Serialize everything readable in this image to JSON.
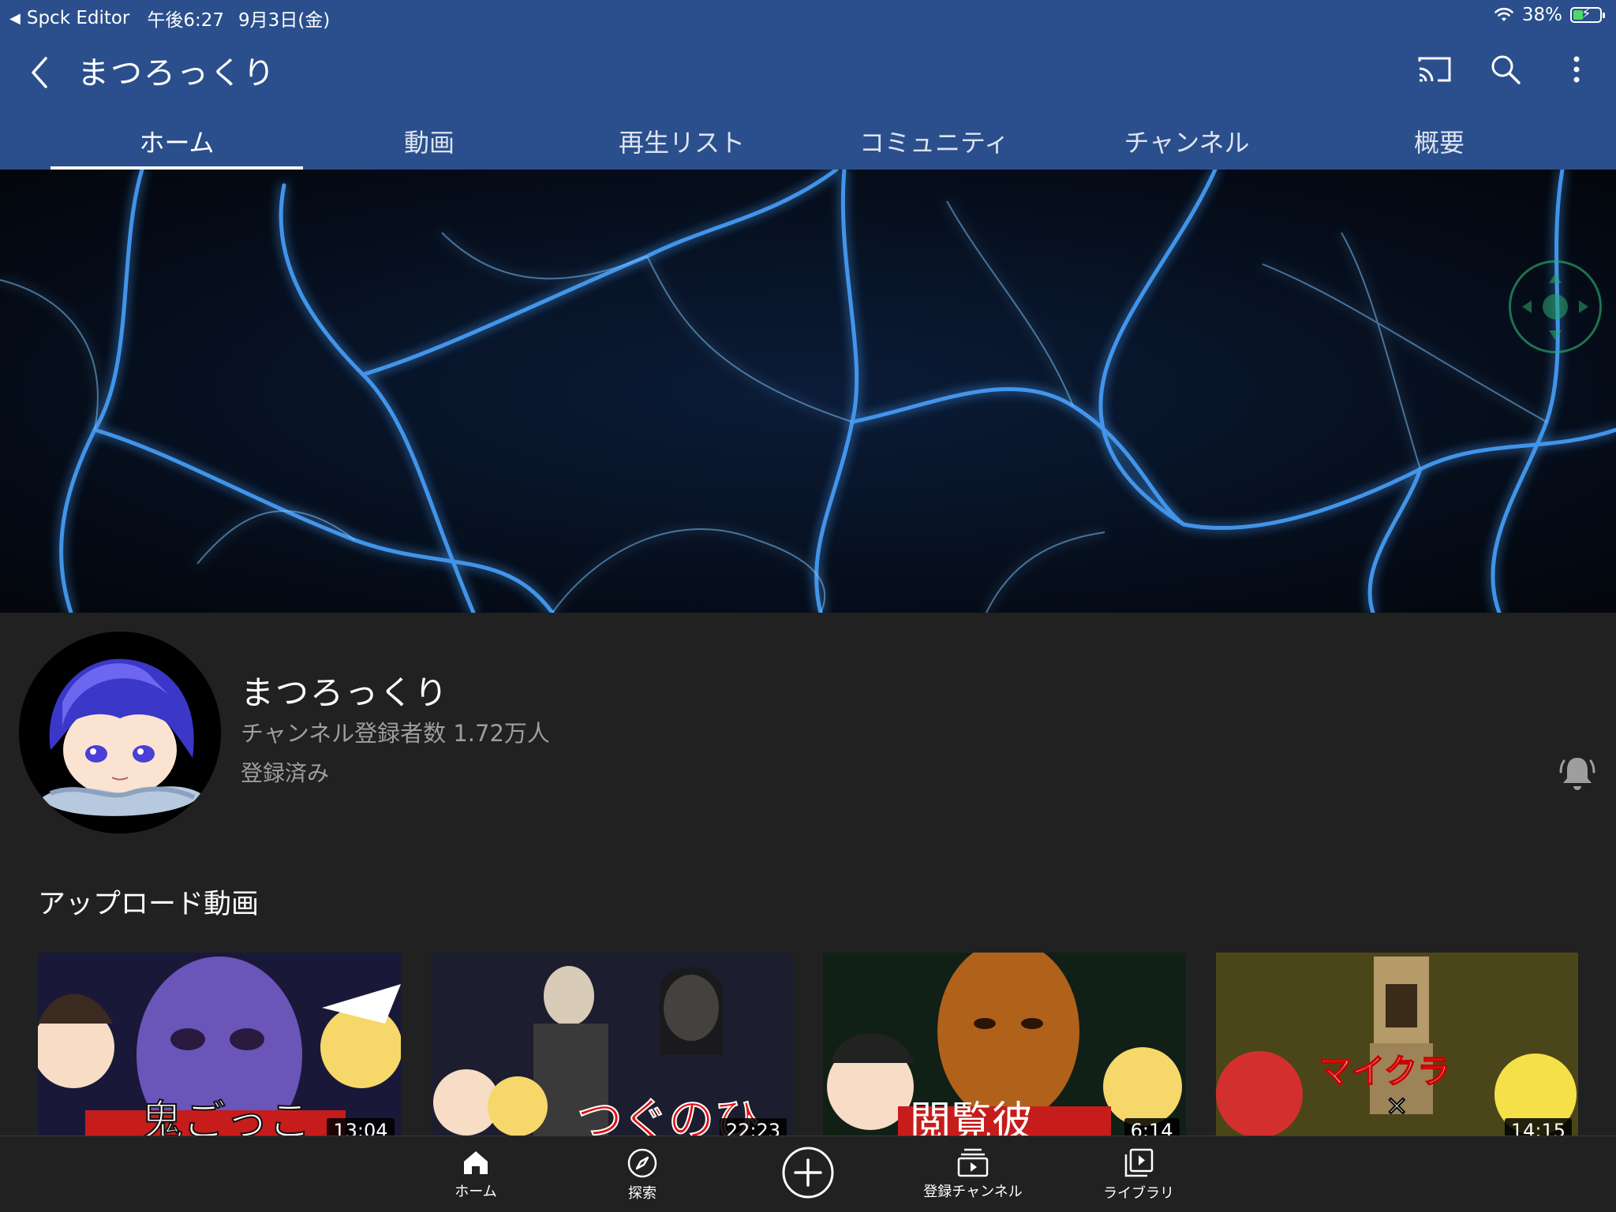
{
  "status_bar": {
    "app_back": "Spck Editor",
    "time": "午後6:27",
    "date": "9月3日(金)",
    "battery": "38%",
    "battery_level": 0.38
  },
  "header": {
    "title": "まつろっくり",
    "icons": [
      "back-chevron-icon",
      "cast-icon",
      "search-icon",
      "more-vert-icon"
    ]
  },
  "tabs": [
    {
      "label": "ホーム",
      "active": true
    },
    {
      "label": "動画",
      "active": false
    },
    {
      "label": "再生リスト",
      "active": false
    },
    {
      "label": "コミュニティ",
      "active": false
    },
    {
      "label": "チャンネル",
      "active": false
    },
    {
      "label": "概要",
      "active": false
    }
  ],
  "channel": {
    "name": "まつろっくり",
    "subscribers": "チャンネル登録者数 1.72万人",
    "subscription_state": "登録済み"
  },
  "uploads": {
    "section_title": "アップロード動画",
    "videos": [
      {
        "duration": "13:04",
        "overlay_text": "鬼ごっこ"
      },
      {
        "duration": "22:23",
        "overlay_text": "つぐのひ"
      },
      {
        "duration": "6:14",
        "overlay_text": "閲覧彼"
      },
      {
        "duration": "14:15",
        "overlay_text": "マイクラ"
      }
    ]
  },
  "bottom_nav": [
    {
      "label": "ホーム",
      "icon": "home-icon"
    },
    {
      "label": "探索",
      "icon": "explore-icon"
    },
    {
      "label": "",
      "icon": "create-plus-icon"
    },
    {
      "label": "登録チャンネル",
      "icon": "subscriptions-icon"
    },
    {
      "label": "ライブラリ",
      "icon": "library-icon"
    }
  ],
  "colors": {
    "header_bg": "#2b4f8c",
    "page_bg": "#212121",
    "secondary_text": "#9e9e9e",
    "battery_green": "#4cd964"
  }
}
